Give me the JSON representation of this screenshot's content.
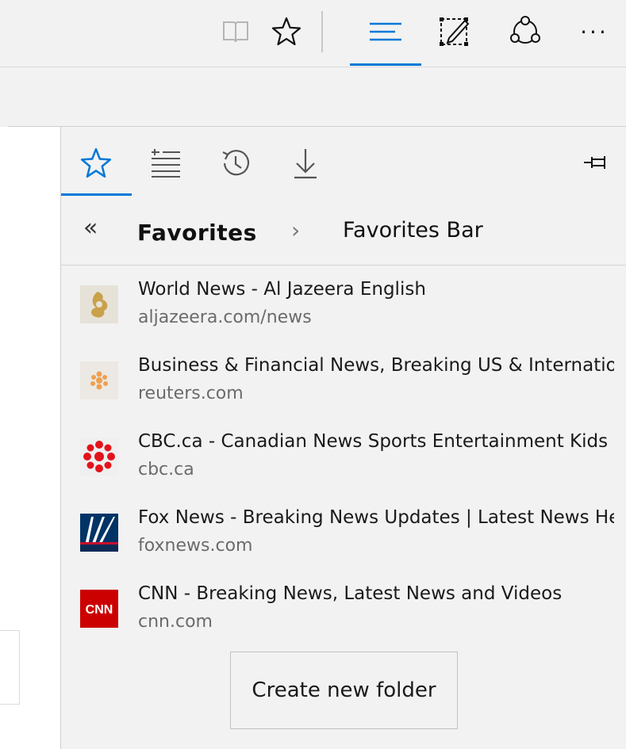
{
  "toolbar": {
    "icons": [
      "reading-view-icon",
      "add-favorite-star-icon",
      "hub-icon",
      "web-note-icon",
      "share-icon",
      "more-icon"
    ],
    "more_label": "···"
  },
  "hub": {
    "tabs": [
      "favorites-star-icon",
      "reading-list-icon",
      "history-icon",
      "downloads-icon"
    ],
    "active_tab": "favorites",
    "pin_icon": "pin-icon",
    "breadcrumb": {
      "back": "«",
      "current": "Favorites",
      "separator": "›",
      "next": "Favorites Bar"
    },
    "items": [
      {
        "title": "World News - Al Jazeera English",
        "url": "aljazeera.com/news",
        "icon": "aljazeera-logo"
      },
      {
        "title": "Business & Financial News, Breaking US & International News",
        "url": "reuters.com",
        "icon": "reuters-logo"
      },
      {
        "title": "CBC.ca - Canadian News Sports Entertainment Kids Docs",
        "url": "cbc.ca",
        "icon": "cbc-logo"
      },
      {
        "title": "Fox News - Breaking News Updates | Latest News Headlines",
        "url": "foxnews.com",
        "icon": "foxnews-logo"
      },
      {
        "title": "CNN - Breaking News, Latest News and Videos",
        "url": "cnn.com",
        "icon": "cnn-logo"
      }
    ],
    "create_folder_label": "Create new folder"
  },
  "colors": {
    "accent": "#0078d7",
    "background": "#f2f2f2",
    "cbc_red": "#e3131b",
    "cnn_red": "#cc0000",
    "fox_blue": "#003366"
  }
}
